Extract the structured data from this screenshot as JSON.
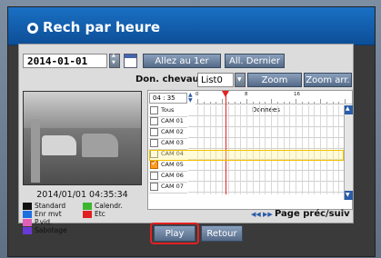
{
  "window": {
    "title": "Rech par heure"
  },
  "date": {
    "value": "2014-01-01"
  },
  "buttons": {
    "first": "Allez au 1er",
    "last": "All. Dernier",
    "zoom_in": "Zoom avant",
    "zoom_out": "Zoom arr.",
    "play": "Play",
    "back": "Retour"
  },
  "overlap": {
    "label": "Don. chevauch.",
    "value": "List0"
  },
  "timeline": {
    "time": "04 : 35",
    "ticks": [
      "0",
      "8",
      "16"
    ],
    "header_all": "Tous",
    "header_data": "Données",
    "playhead_hour": 4.58,
    "rows": [
      {
        "label": "CAM 01",
        "checked": false
      },
      {
        "label": "CAM 02",
        "checked": false
      },
      {
        "label": "CAM 03",
        "checked": false
      },
      {
        "label": "CAM 04",
        "checked": false
      },
      {
        "label": "CAM 05",
        "checked": true
      },
      {
        "label": "CAM 06",
        "checked": false
      },
      {
        "label": "CAM 07",
        "checked": false
      }
    ],
    "selected_row": "CAM 05"
  },
  "video": {
    "timestamp": "2014/01/01 04:35:34"
  },
  "legend": [
    {
      "label": "Standard",
      "color": "#111111"
    },
    {
      "label": "Calendr.",
      "color": "#3cb62f"
    },
    {
      "label": "Enr mvt",
      "color": "#1e6fe0"
    },
    {
      "label": "Etc",
      "color": "#e02020"
    },
    {
      "label": "P.vid.",
      "color": "#e060b8"
    },
    {
      "label": "Sabotage",
      "color": "#6a3ad6"
    }
  ],
  "pager": {
    "label": "Page préc/suiv"
  },
  "accent": "#0d4e97"
}
